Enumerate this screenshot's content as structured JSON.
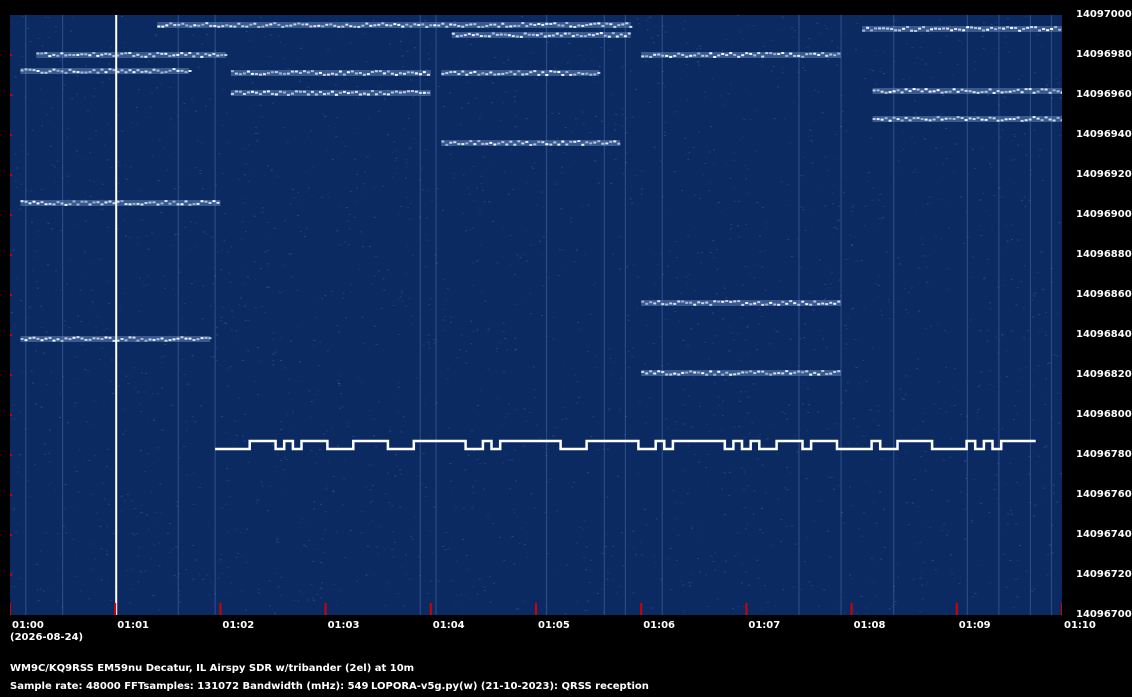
{
  "chart_data": {
    "type": "heatmap",
    "y_axis": {
      "ticks": [
        "14097000",
        "14096980",
        "14096960",
        "14096940",
        "14096920",
        "14096900",
        "14096880",
        "14096860",
        "14096840",
        "14096820",
        "14096800",
        "14096780",
        "14096760",
        "14096740",
        "14096720",
        "14096700"
      ],
      "range": [
        14096700,
        14097000
      ],
      "tick_color": "#d40000"
    },
    "x_axis": {
      "ticks": [
        "01:00",
        "01:01",
        "01:02",
        "01:03",
        "01:04",
        "01:05",
        "01:06",
        "01:07",
        "01:08",
        "01:09",
        "01:10"
      ],
      "range": [
        "01:00",
        "01:10"
      ],
      "tick_color": "#d40000"
    },
    "background_color": "#0c2a62",
    "signal_color": "#ffffff",
    "traces": [
      {
        "t_start": 0.25,
        "t_end": 2.05,
        "freq": 14096980
      },
      {
        "t_start": 1.4,
        "t_end": 5.9,
        "freq": 14096995
      },
      {
        "t_start": 4.2,
        "t_end": 5.9,
        "freq": 14096990
      },
      {
        "t_start": 6.0,
        "t_end": 7.9,
        "freq": 14096980
      },
      {
        "t_start": 8.1,
        "t_end": 10.0,
        "freq": 14096993
      },
      {
        "t_start": 0.1,
        "t_end": 1.7,
        "freq": 14096972
      },
      {
        "t_start": 2.1,
        "t_end": 4.0,
        "freq": 14096971
      },
      {
        "t_start": 2.1,
        "t_end": 4.0,
        "freq": 14096961
      },
      {
        "t_start": 4.1,
        "t_end": 5.6,
        "freq": 14096971
      },
      {
        "t_start": 4.1,
        "t_end": 5.8,
        "freq": 14096936
      },
      {
        "t_start": 8.2,
        "t_end": 10.0,
        "freq": 14096962
      },
      {
        "t_start": 8.2,
        "t_end": 10.0,
        "freq": 14096948
      },
      {
        "t_start": 0.1,
        "t_end": 2.0,
        "freq": 14096906
      },
      {
        "t_start": 6.0,
        "t_end": 7.9,
        "freq": 14096856
      },
      {
        "t_start": 0.1,
        "t_end": 1.9,
        "freq": 14096838
      },
      {
        "t_start": 6.0,
        "t_end": 7.9,
        "freq": 14096821
      }
    ],
    "carrier_line_time": "01:01",
    "fsk_signal": {
      "t_start": 1.95,
      "t_end": 9.75,
      "freq_low": 14096783,
      "freq_high": 14096787,
      "pattern": [
        0,
        0,
        0,
        0,
        1,
        1,
        1,
        0,
        1,
        0,
        1,
        1,
        1,
        0,
        0,
        0,
        1,
        1,
        1,
        1,
        0,
        0,
        0,
        1,
        1,
        1,
        1,
        1,
        1,
        0,
        0,
        1,
        0,
        1,
        1,
        1,
        1,
        1,
        1,
        1,
        0,
        0,
        0,
        1,
        1,
        1,
        1,
        1,
        1,
        0,
        0,
        1,
        0,
        1,
        1,
        1,
        1,
        1,
        1,
        0,
        1,
        0,
        1,
        0,
        0,
        1,
        1,
        1,
        0,
        1,
        1,
        1,
        0,
        0,
        0,
        0,
        1,
        0,
        0,
        1,
        1,
        1,
        1,
        0,
        0,
        0,
        0,
        1,
        0,
        1,
        0,
        1,
        1,
        1,
        1
      ]
    }
  },
  "x_axis_date": "(2026-08-24)",
  "info": {
    "line1": "WM9C/KQ9RSS EM59nu Decatur, IL  Airspy SDR w/tribander (2el) at 10m",
    "line2a": "Sample rate: 48000    FFTsamples: 131072    Bandwidth (mHz): 549",
    "line2b": "LOPORA-v5g.py(w) (21-10-2023): QRSS reception"
  }
}
